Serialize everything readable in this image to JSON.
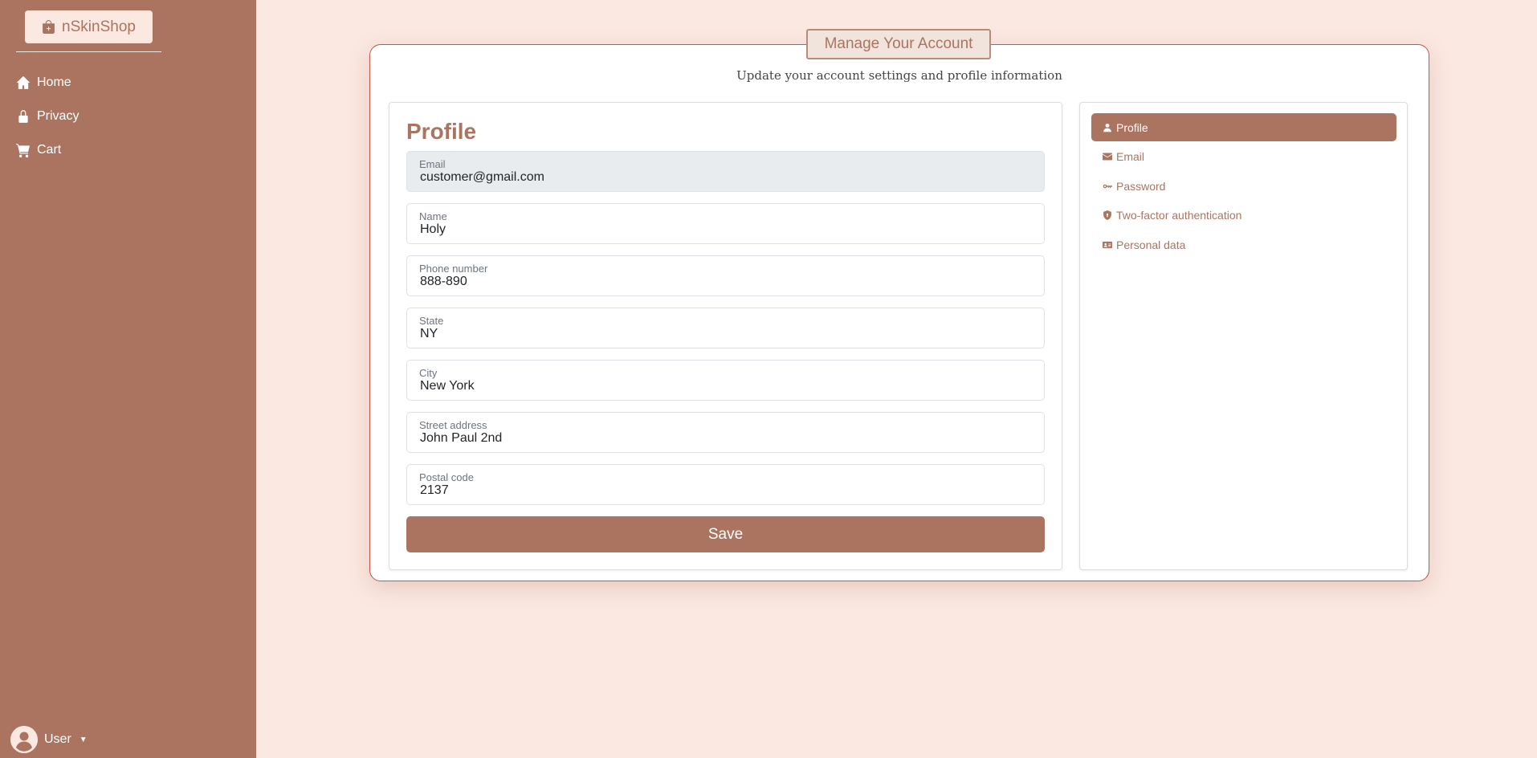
{
  "brand": {
    "name": "nSkinShop"
  },
  "nav": [
    {
      "label": "Home",
      "icon": "home-icon"
    },
    {
      "label": "Privacy",
      "icon": "lock-icon"
    },
    {
      "label": "Cart",
      "icon": "cart-icon"
    }
  ],
  "user": {
    "label": "User"
  },
  "page": {
    "title": "Manage Your Account",
    "subtitle": "Update your account settings and profile information"
  },
  "profile": {
    "heading": "Profile",
    "fields": [
      {
        "label": "Email",
        "value": "customer@gmail.com",
        "readonly": true
      },
      {
        "label": "Name",
        "value": "Holy"
      },
      {
        "label": "Phone number",
        "value": "888-890"
      },
      {
        "label": "State",
        "value": "NY"
      },
      {
        "label": "City",
        "value": "New York"
      },
      {
        "label": "Street address",
        "value": "John Paul 2nd"
      },
      {
        "label": "Postal code",
        "value": "2137"
      }
    ],
    "save_label": "Save"
  },
  "account_nav": [
    {
      "label": "Profile",
      "icon": "person-icon",
      "active": true
    },
    {
      "label": "Email",
      "icon": "envelope-icon"
    },
    {
      "label": "Password",
      "icon": "key-icon"
    },
    {
      "label": "Two-factor authentication",
      "icon": "shield-icon"
    },
    {
      "label": "Personal data",
      "icon": "id-card-icon"
    }
  ],
  "colors": {
    "accent": "#ab7461",
    "background": "#fbe8e1",
    "card_border": "#c4574a",
    "readonly_field": "#e9ecef"
  }
}
